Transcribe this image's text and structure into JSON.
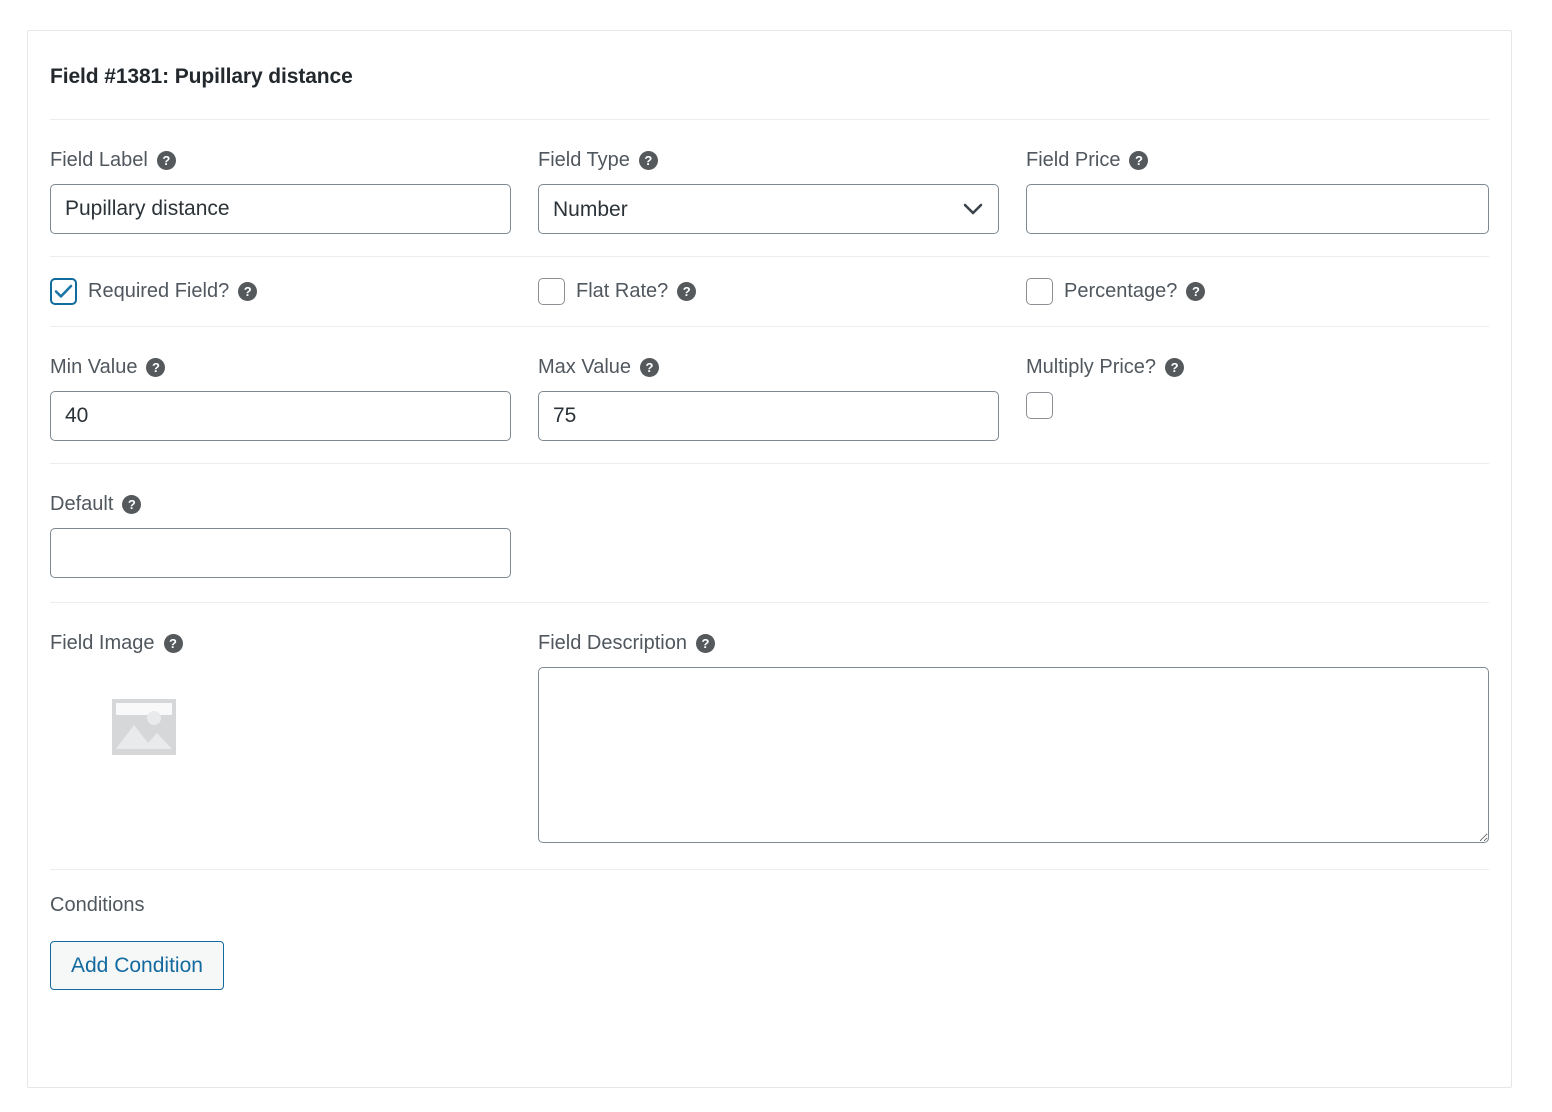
{
  "card": {
    "title": "Field #1381: Pupillary distance"
  },
  "help_glyph": "?",
  "row_label_type_price": {
    "field_label": {
      "label": "Field Label",
      "value": "Pupillary distance",
      "placeholder": ""
    },
    "field_type": {
      "label": "Field Type",
      "value": "Number",
      "options": [
        "Number"
      ]
    },
    "field_price": {
      "label": "Field Price",
      "value": "",
      "placeholder": ""
    }
  },
  "row_checkboxes": {
    "required_field": {
      "label": "Required Field?",
      "checked": true
    },
    "flat_rate": {
      "label": "Flat Rate?",
      "checked": false
    },
    "percentage": {
      "label": "Percentage?",
      "checked": false
    }
  },
  "row_minmax": {
    "min_value": {
      "label": "Min Value",
      "value": "40",
      "placeholder": ""
    },
    "max_value": {
      "label": "Max Value",
      "value": "75",
      "placeholder": ""
    },
    "multiply_price": {
      "label": "Multiply Price?",
      "checked": false
    }
  },
  "row_default": {
    "default": {
      "label": "Default",
      "value": "",
      "placeholder": ""
    }
  },
  "row_image_description": {
    "field_image": {
      "label": "Field Image"
    },
    "field_description": {
      "label": "Field Description",
      "value": "",
      "placeholder": ""
    }
  },
  "conditions": {
    "label": "Conditions",
    "add_button": "Add Condition"
  },
  "colors": {
    "accent_blue": "#136a9f",
    "checkbox_blue": "#0f6c9c",
    "label_gray": "#50575e",
    "border_gray": "#7e8993",
    "divider": "#eceded",
    "card_border": "#e6e6e8"
  }
}
